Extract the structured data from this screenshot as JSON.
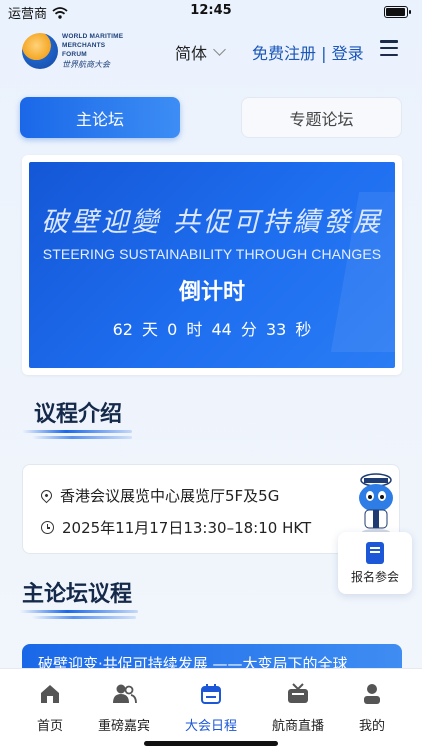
{
  "status_bar": {
    "carrier": "运营商",
    "time": "12:45"
  },
  "header": {
    "logo_en": "WORLD MARITIME MERCHANTS FORUM",
    "logo_cn": "世界航商大会",
    "lang": "简体",
    "auth": "免费注册 | 登录"
  },
  "tabs": [
    {
      "label": "主论坛",
      "active": true
    },
    {
      "label": "专题论坛",
      "active": false
    }
  ],
  "banner": {
    "slogan_cn": "破壁迎變 共促可持續發展",
    "slogan_en": "STEERING SUSTAINABILITY THROUGH CHANGES",
    "countdown_title": "倒计时",
    "countdown": "62 天 0 时 44 分 33 秒"
  },
  "agenda_intro": {
    "title": "议程介绍",
    "location": "香港会议展览中心展览厅5F及5G",
    "datetime": "2025年11月17日13:30–18:10 HKT"
  },
  "register": {
    "label": "报名参会"
  },
  "main_agenda": {
    "title": "主论坛议程",
    "first_item": "破壁迎变·共促可持续发展 ——大变局下的全球"
  },
  "tabbar": [
    {
      "label": "首页",
      "icon": "home-icon",
      "active": false
    },
    {
      "label": "重磅嘉宾",
      "icon": "guests-icon",
      "active": false
    },
    {
      "label": "大会日程",
      "icon": "calendar-icon",
      "active": true
    },
    {
      "label": "航商直播",
      "icon": "tv-icon",
      "active": false
    },
    {
      "label": "我的",
      "icon": "profile-icon",
      "active": false
    }
  ],
  "colors": {
    "accent": "#1a68e8",
    "active_tab": "#1b57d6",
    "banner": "#1e6ef0"
  }
}
